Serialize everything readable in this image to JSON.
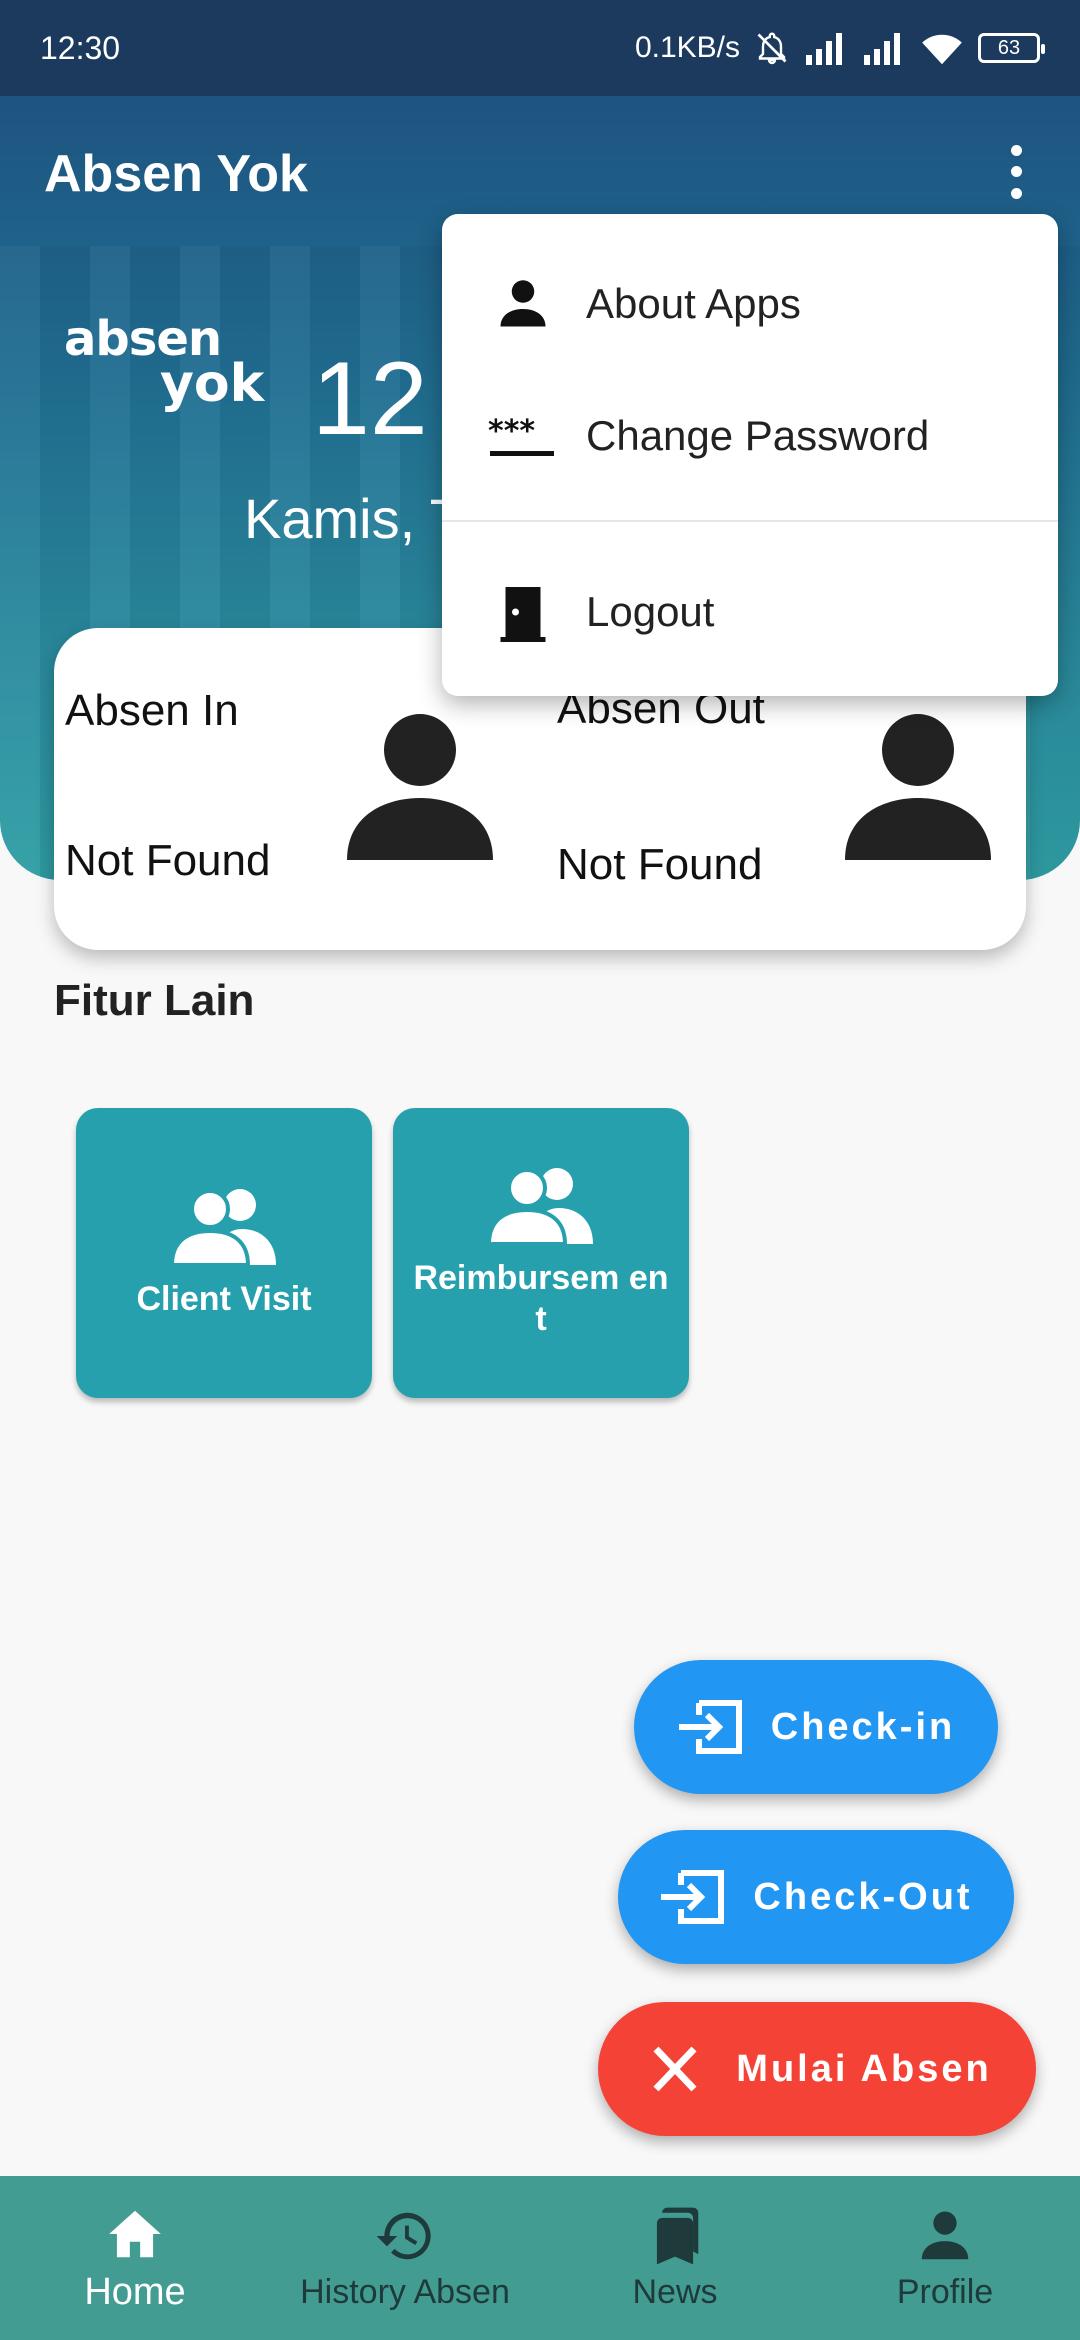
{
  "status_bar": {
    "time": "12:30",
    "network_speed": "0.1KB/s",
    "battery": "63",
    "icons": [
      "bell-off-icon",
      "signal-icon",
      "signal-icon",
      "wifi-icon",
      "battery-icon"
    ]
  },
  "app": {
    "title": "Absen Yok",
    "logo_line1": "absen",
    "logo_line2": "yok",
    "clock": "12 :",
    "date": "Kamis, T"
  },
  "attendance": {
    "in_label": "Absen In",
    "in_status": "Not Found",
    "out_label": "Absen Out",
    "out_status": "Not Found"
  },
  "features": {
    "title": "Fitur Lain",
    "items": [
      {
        "label": "Client Visit",
        "icon": "people-icon"
      },
      {
        "label": "Reimbursem ent",
        "icon": "people-icon"
      }
    ]
  },
  "actions": {
    "checkin": "Check-in",
    "checkout": "Check-Out",
    "mulai": "Mulai Absen"
  },
  "menu": {
    "items": [
      {
        "label": "About Apps",
        "icon": "person-icon"
      },
      {
        "label": "Change Password",
        "icon": "password-icon"
      },
      {
        "label": "Logout",
        "icon": "door-icon"
      }
    ]
  },
  "nav": {
    "items": [
      {
        "label": "Home",
        "icon": "home-icon",
        "active": true
      },
      {
        "label": "History Absen",
        "icon": "history-icon"
      },
      {
        "label": "News",
        "icon": "bookmarks-icon"
      },
      {
        "label": "Profile",
        "icon": "person-icon"
      }
    ]
  },
  "colors": {
    "header": "#206d92",
    "tile": "#27a0ad",
    "fab_blue": "#2196f3",
    "fab_red": "#f44336",
    "nav": "#439c92"
  }
}
